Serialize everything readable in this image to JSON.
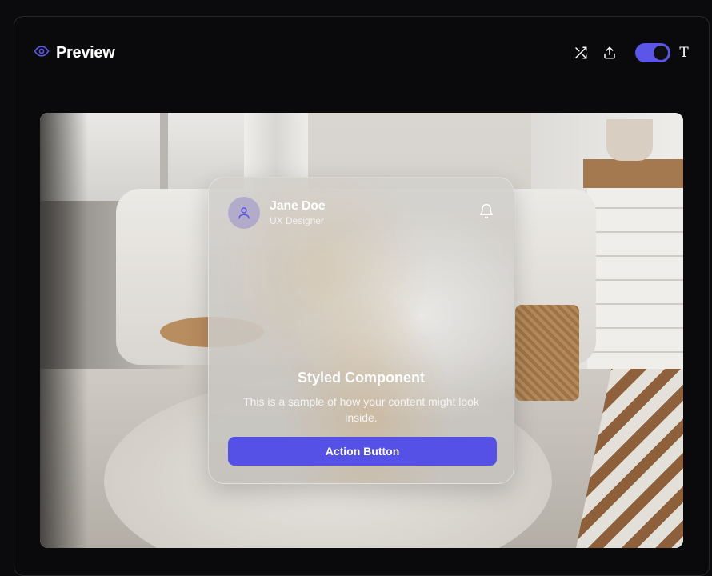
{
  "header": {
    "title": "Preview",
    "eye_icon": "eye-icon",
    "tools": [
      "shuffle-icon",
      "upload-icon"
    ],
    "toggle_on": true,
    "type_label": "T"
  },
  "colors": {
    "accent": "#5b55e8",
    "background": "#0a0a0c"
  },
  "card": {
    "name": "Jane Doe",
    "role": "UX Designer",
    "title": "Styled Component",
    "body": "This is a sample of how your content might look inside.",
    "button_label": "Action Button"
  }
}
